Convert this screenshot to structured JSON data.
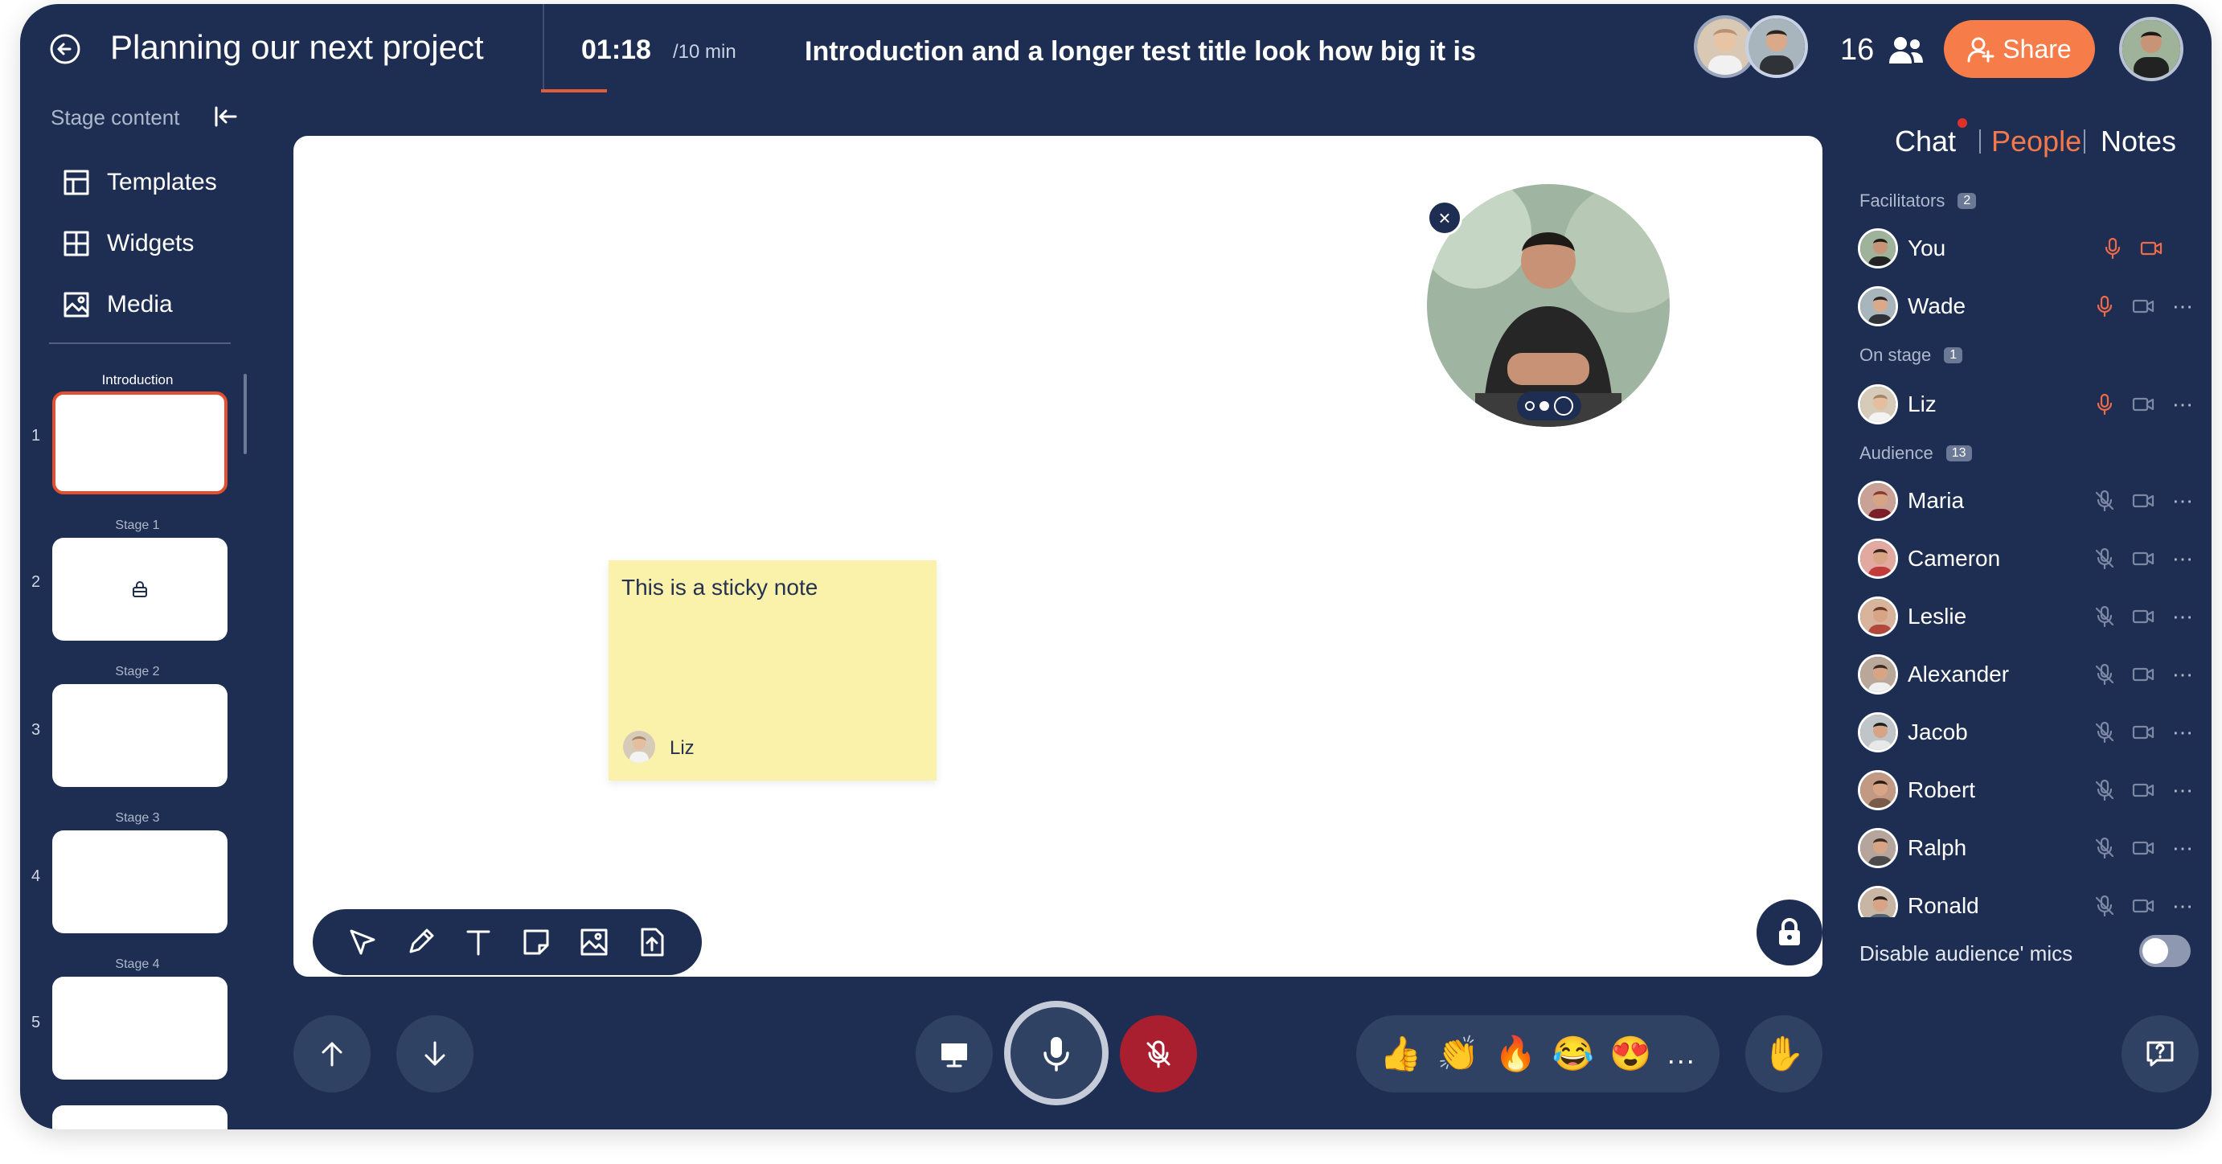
{
  "header": {
    "title": "Planning our next project",
    "timer": "01:18",
    "timer_total": "/10 min",
    "stage_title": "Introduction and a longer test title look how big it is",
    "participant_count": "16",
    "share_label": "Share"
  },
  "left_panel": {
    "stage_content_label": "Stage content",
    "menu": [
      {
        "label": "Templates",
        "icon": "templates-icon"
      },
      {
        "label": "Widgets",
        "icon": "widgets-icon"
      },
      {
        "label": "Media",
        "icon": "media-icon"
      }
    ],
    "stages": [
      {
        "label": "Introduction",
        "number": "1",
        "active": true,
        "locked": false
      },
      {
        "label": "Stage 1",
        "number": "2",
        "active": false,
        "locked": true
      },
      {
        "label": "Stage 2",
        "number": "3",
        "active": false,
        "locked": false
      },
      {
        "label": "Stage 3",
        "number": "4",
        "active": false,
        "locked": false
      },
      {
        "label": "Stage 4",
        "number": "5",
        "active": false,
        "locked": false
      }
    ]
  },
  "canvas": {
    "sticky_note": {
      "text": "This is a sticky note",
      "author": "Liz"
    },
    "tools": [
      "select-tool-icon",
      "pen-tool-icon",
      "text-tool-icon",
      "sticky-note-tool-icon",
      "image-tool-icon",
      "upload-tool-icon"
    ]
  },
  "reactions": [
    "👍",
    "👏",
    "🔥",
    "😂",
    "😍"
  ],
  "reactions_more": "...",
  "right_panel": {
    "tabs": {
      "chat": "Chat",
      "people": "People",
      "notes": "Notes"
    },
    "sections": {
      "facilitators": {
        "label": "Facilitators",
        "count": "2"
      },
      "on_stage": {
        "label": "On stage",
        "count": "1"
      },
      "audience": {
        "label": "Audience",
        "count": "13"
      }
    },
    "facilitators": [
      {
        "name": "You",
        "mic": "on",
        "cam": "on",
        "menu": false
      },
      {
        "name": "Wade",
        "mic": "on",
        "cam": "off",
        "menu": true
      }
    ],
    "on_stage": [
      {
        "name": "Liz",
        "mic": "on",
        "cam": "off",
        "menu": true
      }
    ],
    "audience": [
      {
        "name": "Maria"
      },
      {
        "name": "Cameron"
      },
      {
        "name": "Leslie"
      },
      {
        "name": "Alexander"
      },
      {
        "name": "Jacob"
      },
      {
        "name": "Robert"
      },
      {
        "name": "Ralph"
      },
      {
        "name": "Ronald"
      }
    ],
    "disable_mics_label": "Disable audience' mics",
    "disable_mics_enabled": false
  },
  "colors": {
    "frame_bg": "#1d2e52",
    "accent_orange": "#f67d4a",
    "active_tab": "#f5784a",
    "mic_off_red": "#a91f2f",
    "sticky_yellow": "#faf1ab"
  }
}
